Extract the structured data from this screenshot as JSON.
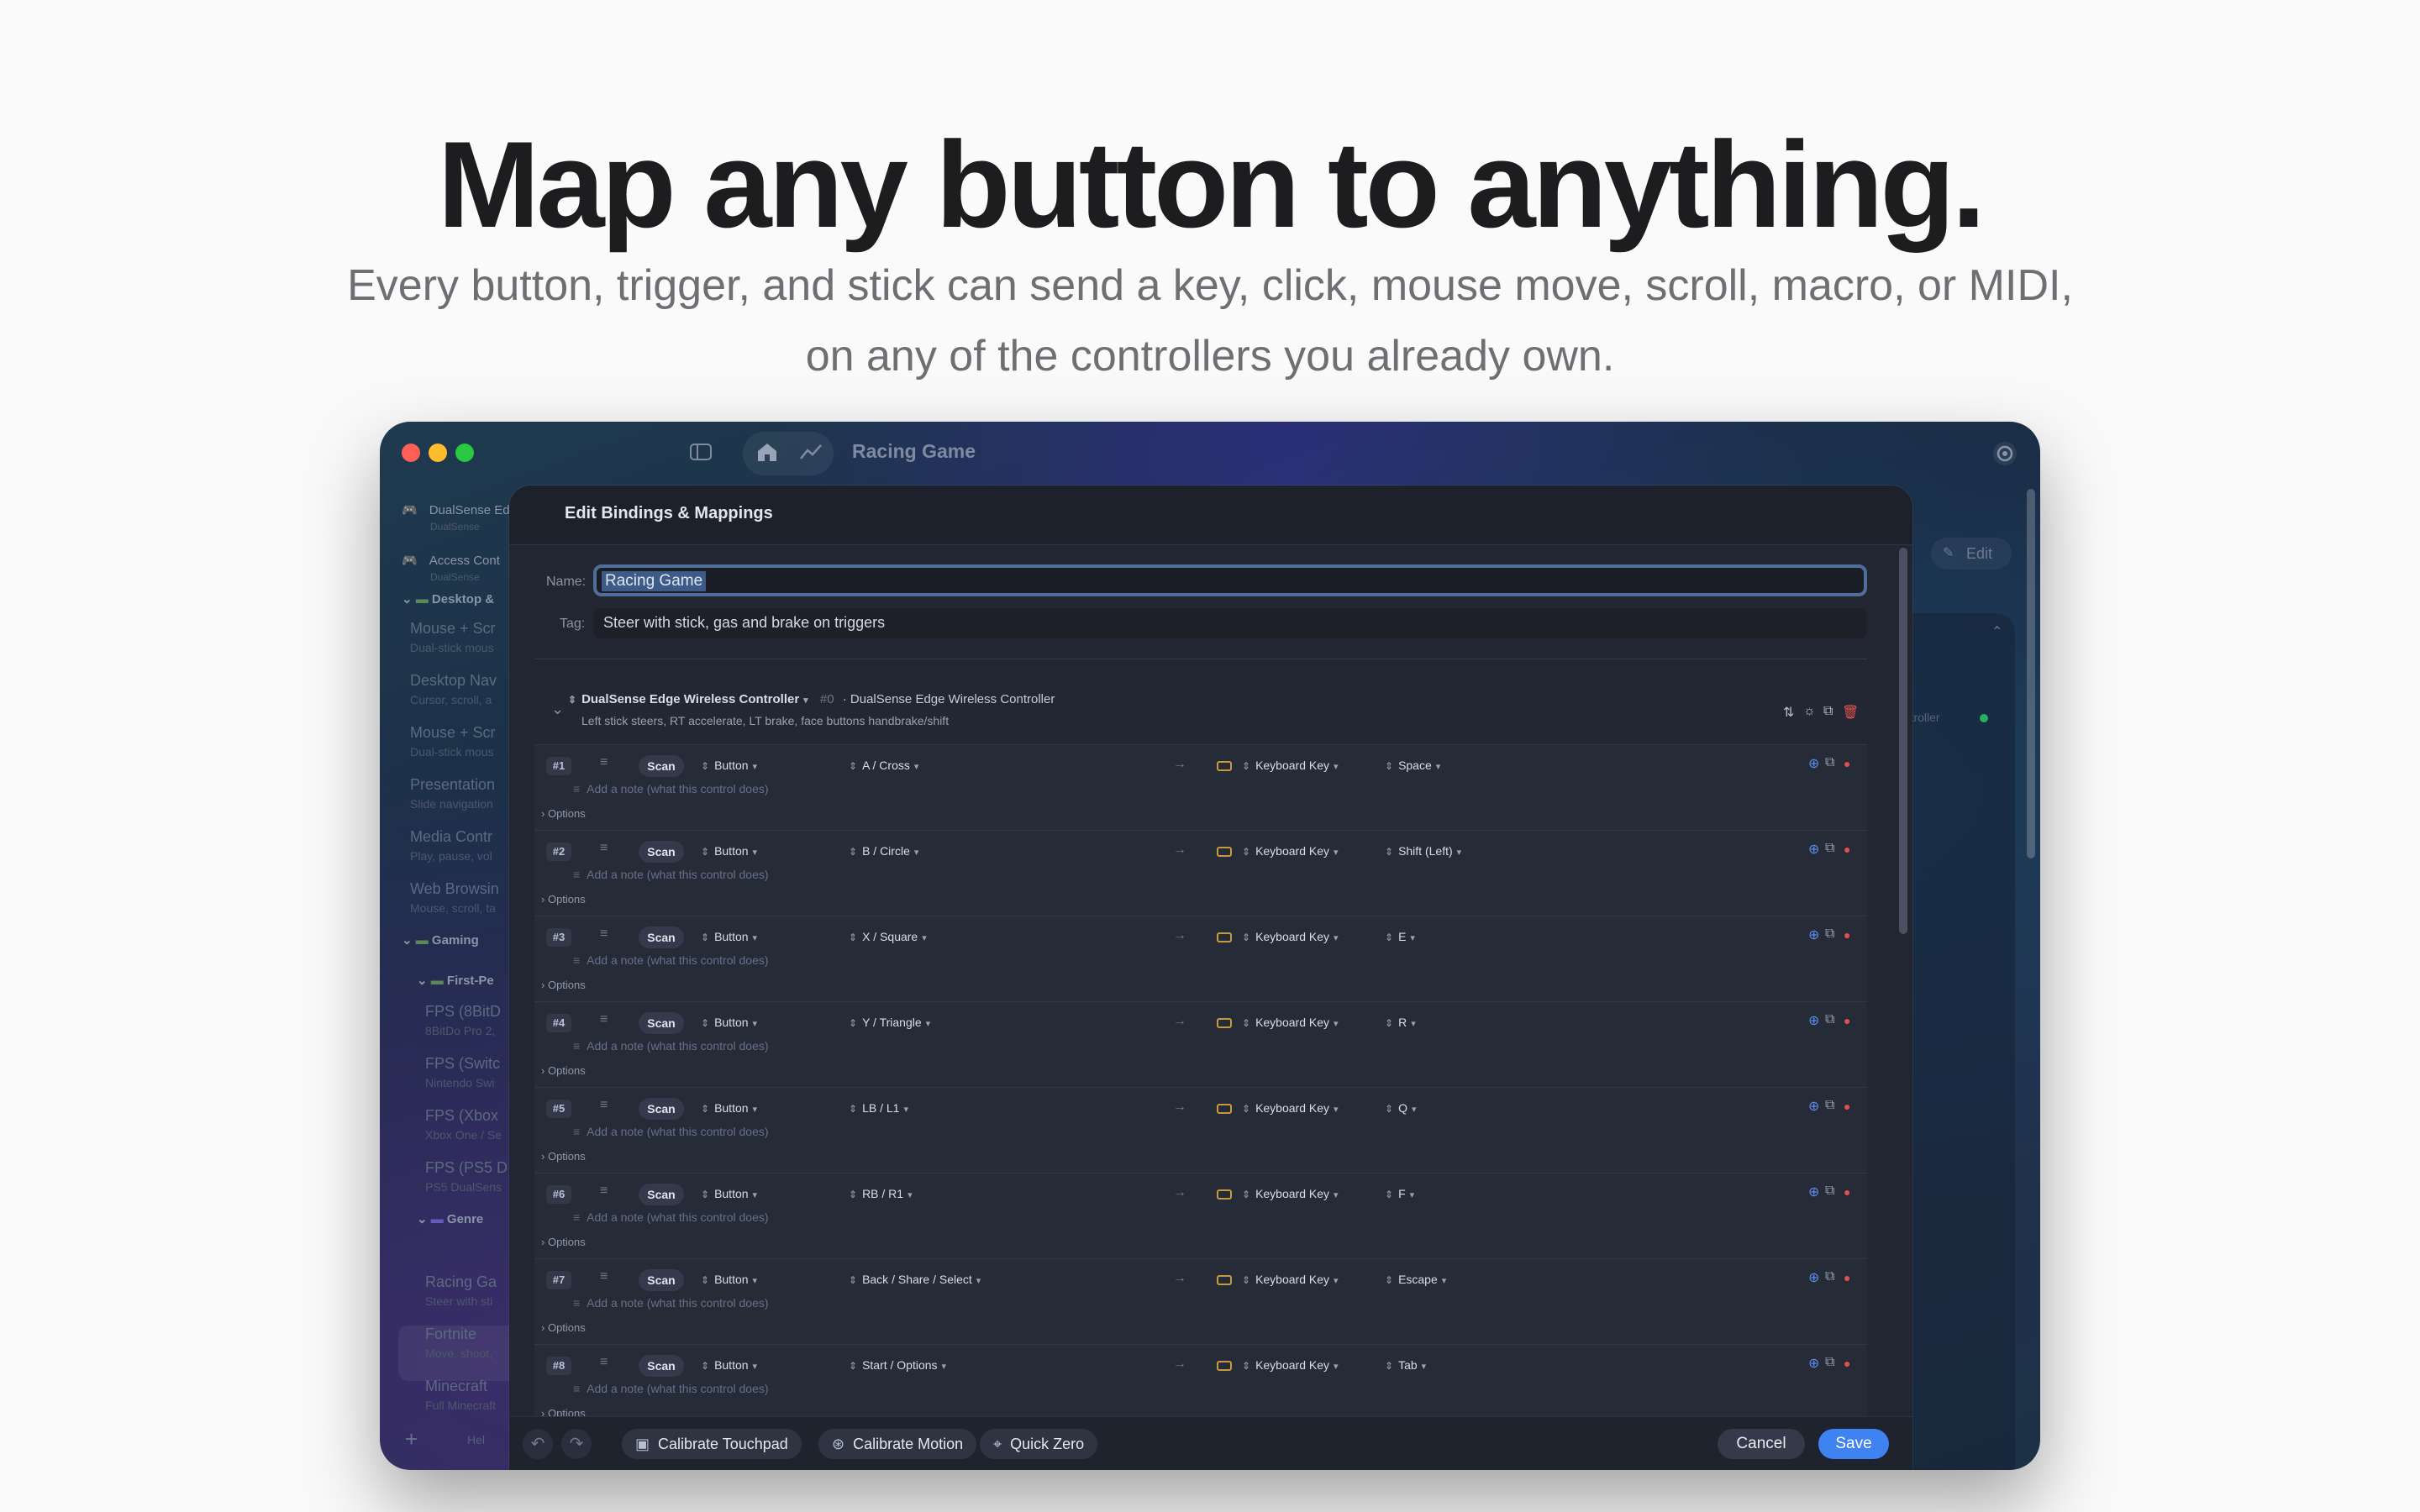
{
  "hero": {
    "title": "Map any button to anything.",
    "subtitle_line1": "Every button, trigger, and stick can send a key, click, mouse move, scroll, macro, or MIDI,",
    "subtitle_line2": "on any of the controllers you already own."
  },
  "window": {
    "title": "Racing Game",
    "edit_label": "Edit",
    "right_peek_text": "ontroller"
  },
  "sidebar": {
    "items": [
      {
        "title": "DualSense Ed",
        "sub": "DualSense"
      },
      {
        "title": "Access Cont",
        "sub": "DualSense"
      },
      {
        "title": "Desktop &",
        "sub": ""
      },
      {
        "title": "Mouse + Scr",
        "sub": "Dual-stick mous"
      },
      {
        "title": "Desktop Nav",
        "sub": "Cursor, scroll, a"
      },
      {
        "title": "Mouse + Scr",
        "sub": "Dual-stick mous"
      },
      {
        "title": "Presentation",
        "sub": "Slide navigation"
      },
      {
        "title": "Media Contr",
        "sub": "Play, pause, vol"
      },
      {
        "title": "Web Browsin",
        "sub": "Mouse, scroll, ta"
      },
      {
        "title": "Gaming",
        "sub": ""
      },
      {
        "title": "First-Pe",
        "sub": ""
      },
      {
        "title": "FPS (8BitD",
        "sub": "8BitDo Pro 2,"
      },
      {
        "title": "FPS (Switc",
        "sub": "Nintendo Swi"
      },
      {
        "title": "FPS (Xbox",
        "sub": "Xbox One / Se"
      },
      {
        "title": "FPS (PS5 D",
        "sub": "PS5 DualSens"
      },
      {
        "title": "Genre",
        "sub": ""
      },
      {
        "title": "Racing Ga",
        "sub": "Steer with sti"
      },
      {
        "title": "Fortnite",
        "sub": "Move, shoot,"
      },
      {
        "title": "Minecraft",
        "sub": "Full Minecraft"
      }
    ],
    "help_label": "Hel"
  },
  "dialog": {
    "title": "Edit Bindings & Mappings",
    "name_label": "Name:",
    "name_value": "Racing Game",
    "tag_label": "Tag:",
    "tag_value": "Steer with stick, gas and brake on triggers",
    "controller": {
      "name": "DualSense Edge Wireless Controller",
      "index": "#0",
      "device": "· DualSense Edge Wireless Controller",
      "description": "Left stick steers, RT accelerate, LT brake, face buttons handbrake/shift"
    },
    "note_placeholder": "Add a note (what this control does)",
    "options_label": "Options",
    "scan_label": "Scan",
    "bindings": [
      {
        "num": "#1",
        "input_type": "Button",
        "control": "A / Cross",
        "action_type": "Keyboard Key",
        "key": "Space"
      },
      {
        "num": "#2",
        "input_type": "Button",
        "control": "B / Circle",
        "action_type": "Keyboard Key",
        "key": "Shift (Left)"
      },
      {
        "num": "#3",
        "input_type": "Button",
        "control": "X / Square",
        "action_type": "Keyboard Key",
        "key": "E"
      },
      {
        "num": "#4",
        "input_type": "Button",
        "control": "Y / Triangle",
        "action_type": "Keyboard Key",
        "key": "R"
      },
      {
        "num": "#5",
        "input_type": "Button",
        "control": "LB / L1",
        "action_type": "Keyboard Key",
        "key": "Q"
      },
      {
        "num": "#6",
        "input_type": "Button",
        "control": "RB / R1",
        "action_type": "Keyboard Key",
        "key": "F"
      },
      {
        "num": "#7",
        "input_type": "Button",
        "control": "Back / Share / Select",
        "action_type": "Keyboard Key",
        "key": "Escape"
      },
      {
        "num": "#8",
        "input_type": "Button",
        "control": "Start / Options",
        "action_type": "Keyboard Key",
        "key": "Tab"
      }
    ],
    "footer": {
      "calibrate_touchpad": "Calibrate Touchpad",
      "calibrate_motion": "Calibrate Motion",
      "quick_zero": "Quick Zero",
      "cancel": "Cancel",
      "save": "Save"
    }
  },
  "colors": {
    "accent": "#3f82f2",
    "delete": "#e2504e",
    "traffic_red": "#ff5f57",
    "traffic_yellow": "#febc2e",
    "traffic_green": "#28c840"
  }
}
